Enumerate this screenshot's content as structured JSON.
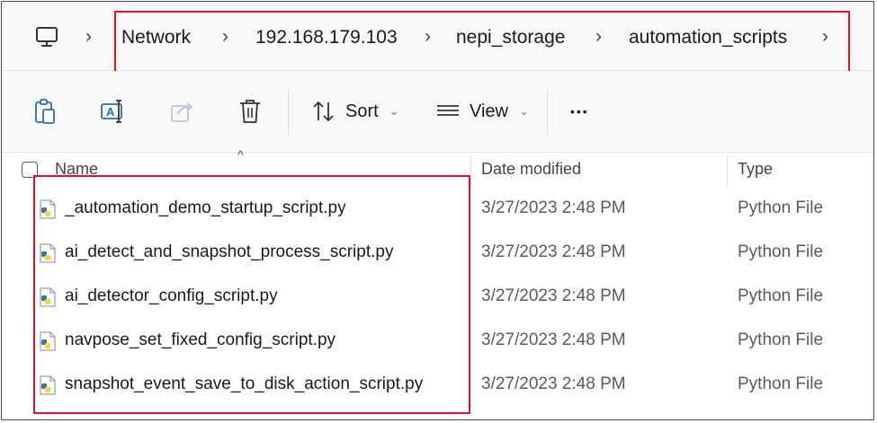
{
  "breadcrumb": {
    "items": [
      "Network",
      "192.168.179.103",
      "nepi_storage",
      "automation_scripts"
    ]
  },
  "toolbar": {
    "sort_label": "Sort",
    "view_label": "View",
    "more_label": "•••"
  },
  "columns": {
    "name": "Name",
    "date": "Date modified",
    "type": "Type"
  },
  "files": [
    {
      "name": "_automation_demo_startup_script.py",
      "date": "3/27/2023 2:48 PM",
      "type": "Python File"
    },
    {
      "name": "ai_detect_and_snapshot_process_script.py",
      "date": "3/27/2023 2:48 PM",
      "type": "Python File"
    },
    {
      "name": "ai_detector_config_script.py",
      "date": "3/27/2023 2:48 PM",
      "type": "Python File"
    },
    {
      "name": "navpose_set_fixed_config_script.py",
      "date": "3/27/2023 2:48 PM",
      "type": "Python File"
    },
    {
      "name": "snapshot_event_save_to_disk_action_script.py",
      "date": "3/27/2023 2:48 PM",
      "type": "Python File"
    }
  ],
  "colors": {
    "highlight_box": "#e81123",
    "python_blue": "#3776ab",
    "python_yellow": "#ffd43b"
  }
}
